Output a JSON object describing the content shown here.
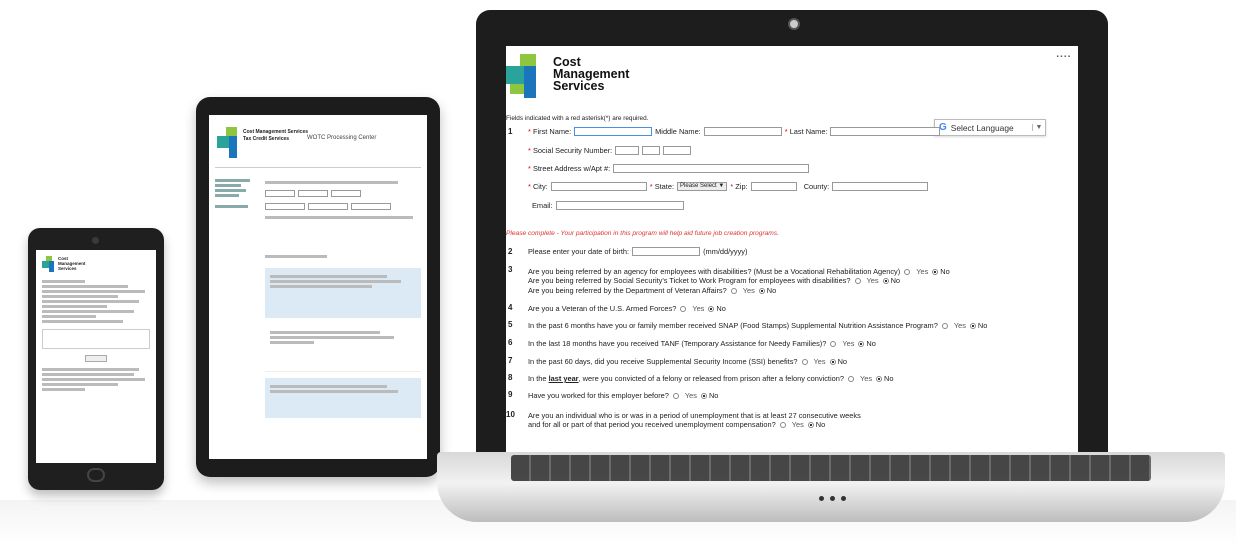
{
  "brand": {
    "line1": "Cost",
    "line2": "Management",
    "line3": "Services"
  },
  "colors": {
    "logo_green": "#8dc63f",
    "logo_blue": "#1b75bc",
    "logo_teal": "#2aa39a",
    "required_red": "#dd0000"
  },
  "laptop": {
    "required_note": "Fields indicated with a red asterisk(*) are required.",
    "language_button": "Select Language",
    "language_icon": "google-g-icon",
    "q1_number": "1",
    "first_name_label": "First Name:",
    "middle_name_label": "Middle Name:",
    "last_name_label": "Last Name:",
    "ssn_label": "Social Security Number:",
    "street_label": "Street Address w/Apt #:",
    "city_label": "City:",
    "state_label": "State:",
    "state_value": "Please Select",
    "zip_label": "Zip:",
    "county_label": "County:",
    "email_label": "Email:",
    "participation_note": "Please complete - Your participation in this program will help aid future job creation programs.",
    "questions": [
      {
        "num": "2",
        "text": "Please enter your date of birth:",
        "suffix": "(mm/dd/yyyy)"
      },
      {
        "num": "3",
        "lines": [
          "Are you being referred by an agency for employees with disabilities? (Must be a Vocational Rehabilitation Agency)",
          "Are you being referred by Social Security's Ticket to Work Program for employees with disabilities?",
          "Are you being referred by the Department of Veteran Affairs?"
        ]
      },
      {
        "num": "4",
        "text": "Are you a Veteran of the U.S. Armed Forces?"
      },
      {
        "num": "5",
        "text": "In the past 6 months have you or family member received SNAP (Food Stamps) Supplemental Nutrition Assistance Program?"
      },
      {
        "num": "6",
        "text": "In the last 18 months have you received TANF (Temporary Assistance for Needy Families)?"
      },
      {
        "num": "7",
        "text": "In the past 60 days, did you receive Supplemental Security Income (SSI) benefits?"
      },
      {
        "num": "8",
        "prefix": "In the",
        "underlined": "last year",
        "text": ", were you convicted of a felony or released from prison after a felony conviction?"
      },
      {
        "num": "9",
        "text": "Have you worked for this employer before?"
      },
      {
        "num": "10",
        "lines": [
          "Are you an individual who is or was in a period of unemployment that is at least 27 consecutive weeks",
          "and for all or part of that period you received unemployment compensation?"
        ]
      }
    ],
    "yes_label": "Yes",
    "no_label": "No"
  },
  "tablet": {
    "brand_line1": "Cost Management Services",
    "brand_line2": "Tax Credit Services",
    "page_title": "WOTC Processing Center"
  }
}
